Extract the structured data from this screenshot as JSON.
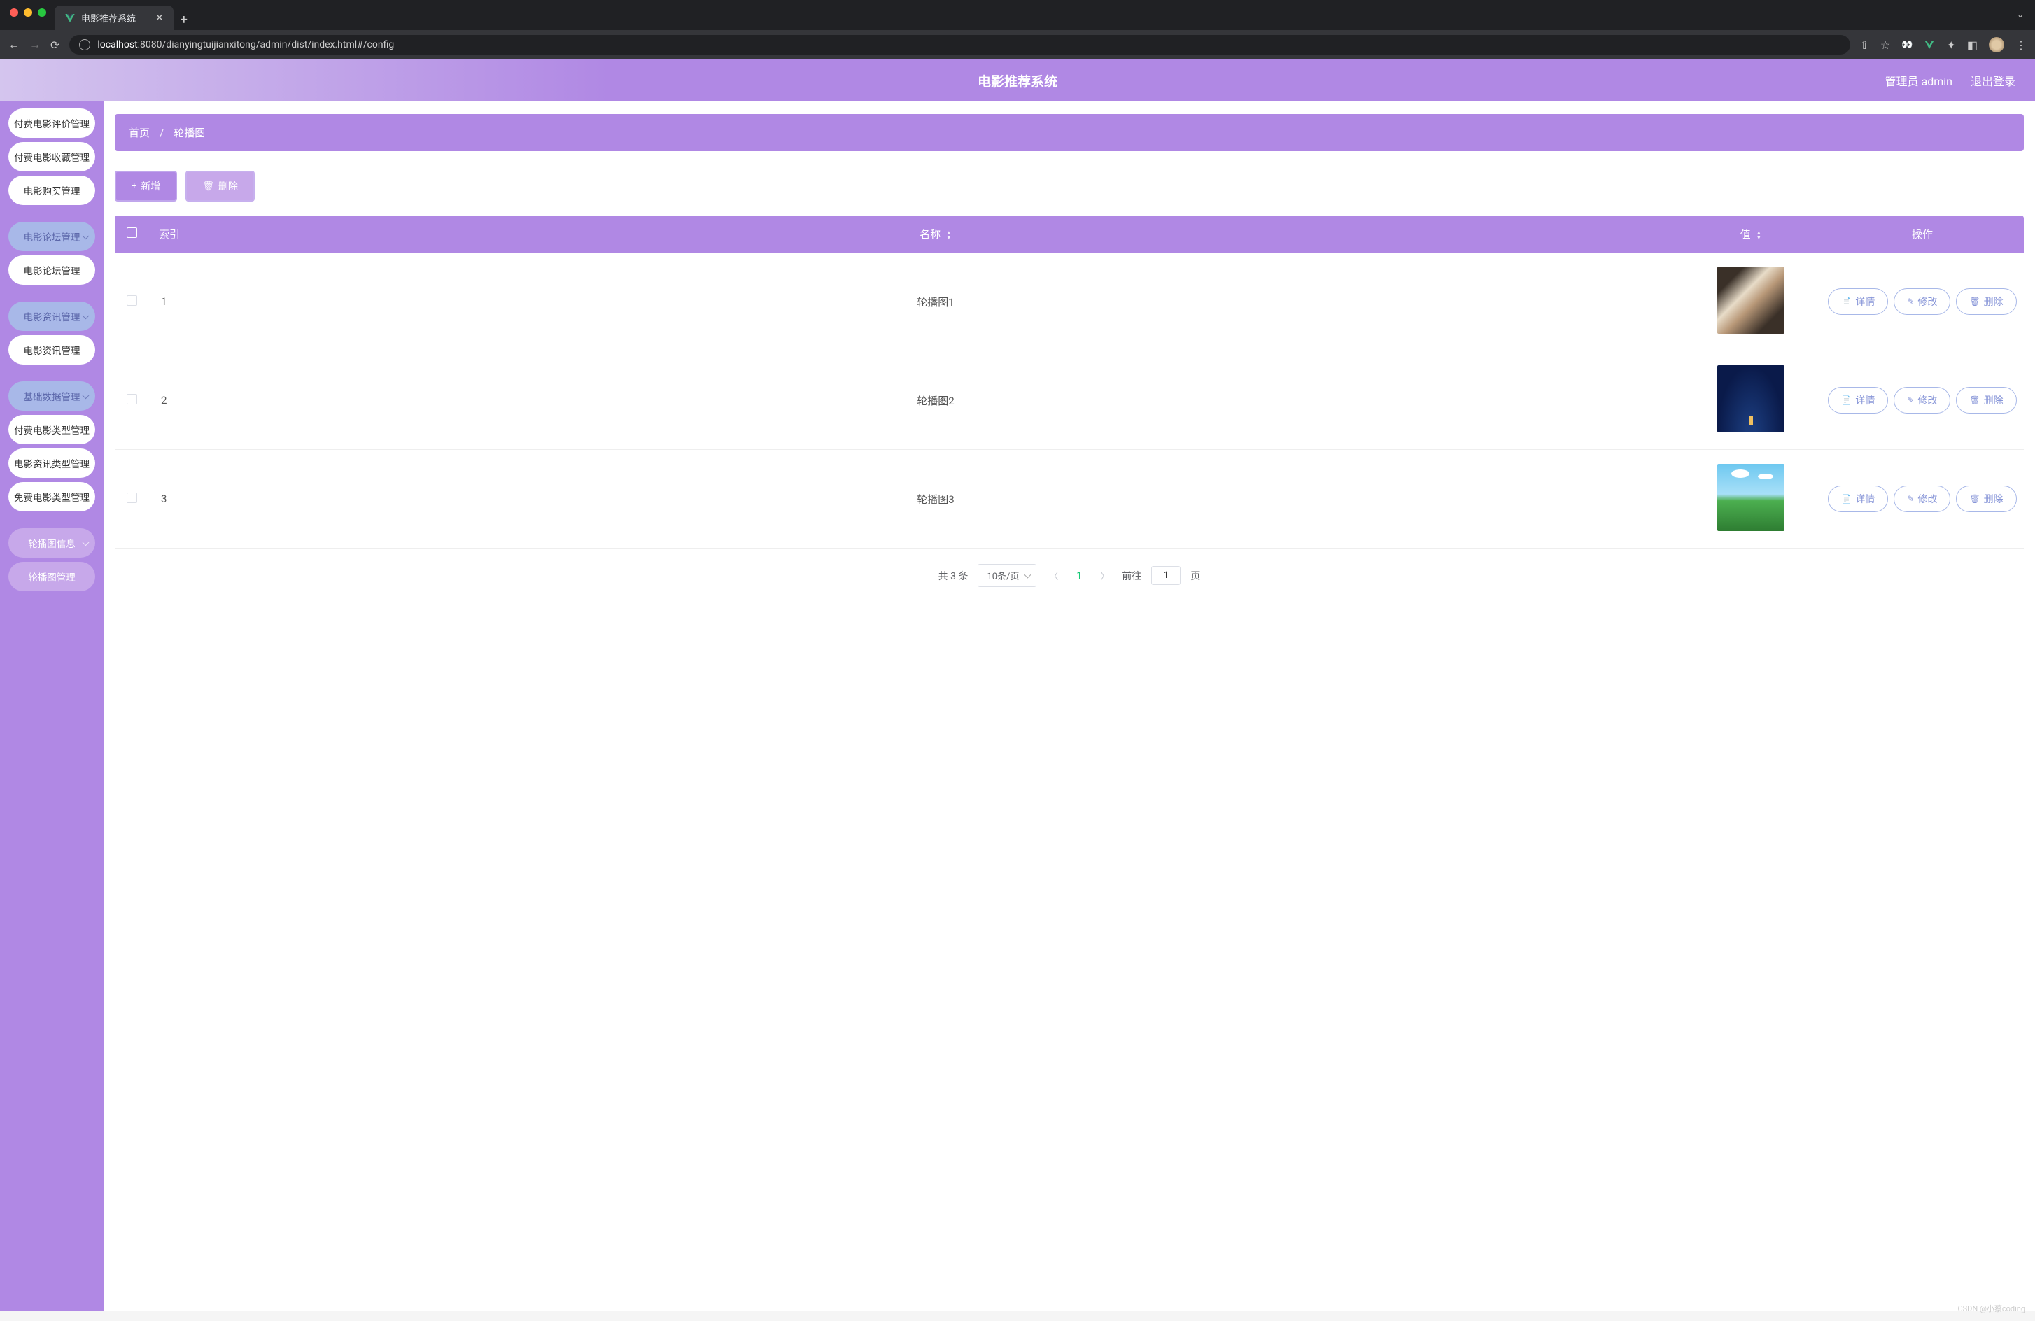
{
  "browser": {
    "tab_title": "电影推荐系统",
    "url_host": "localhost",
    "url_port_path": ":8080/dianyingtuijianxitong/admin/dist/index.html#/config"
  },
  "header": {
    "title": "电影推荐系统",
    "user_label": "管理员 admin",
    "logout": "退出登录"
  },
  "sidebar": {
    "items": [
      {
        "label": "付费电影评价管理",
        "style": "white"
      },
      {
        "label": "付费电影收藏管理",
        "style": "white"
      },
      {
        "label": "电影购买管理",
        "style": "white"
      },
      {
        "label": "电影论坛管理",
        "style": "blue",
        "chevron": true
      },
      {
        "label": "电影论坛管理",
        "style": "white"
      },
      {
        "label": "电影资讯管理",
        "style": "blue",
        "chevron": true
      },
      {
        "label": "电影资讯管理",
        "style": "white"
      },
      {
        "label": "基础数据管理",
        "style": "blue",
        "chevron": true
      },
      {
        "label": "付费电影类型管理",
        "style": "white"
      },
      {
        "label": "电影资讯类型管理",
        "style": "white"
      },
      {
        "label": "免费电影类型管理",
        "style": "white"
      },
      {
        "label": "轮播图信息",
        "style": "purple",
        "chevron": true
      },
      {
        "label": "轮播图管理",
        "style": "purple"
      }
    ]
  },
  "breadcrumb": {
    "home": "首页",
    "current": "轮播图"
  },
  "toolbar": {
    "add": "新增",
    "delete": "删除"
  },
  "table": {
    "headers": {
      "index": "索引",
      "name": "名称",
      "value": "值",
      "ops": "操作"
    },
    "rows": [
      {
        "index": "1",
        "name": "轮播图1",
        "thumb": "thumb1"
      },
      {
        "index": "2",
        "name": "轮播图2",
        "thumb": "thumb2"
      },
      {
        "index": "3",
        "name": "轮播图3",
        "thumb": "thumb3"
      }
    ],
    "ops": {
      "detail": "详情",
      "edit": "修改",
      "delete": "删除"
    }
  },
  "pagination": {
    "total_text": "共 3 条",
    "page_size": "10条/页",
    "current_page": "1",
    "goto_prefix": "前往",
    "goto_value": "1",
    "goto_suffix": "页"
  },
  "watermark": "CSDN @小蔡coding"
}
